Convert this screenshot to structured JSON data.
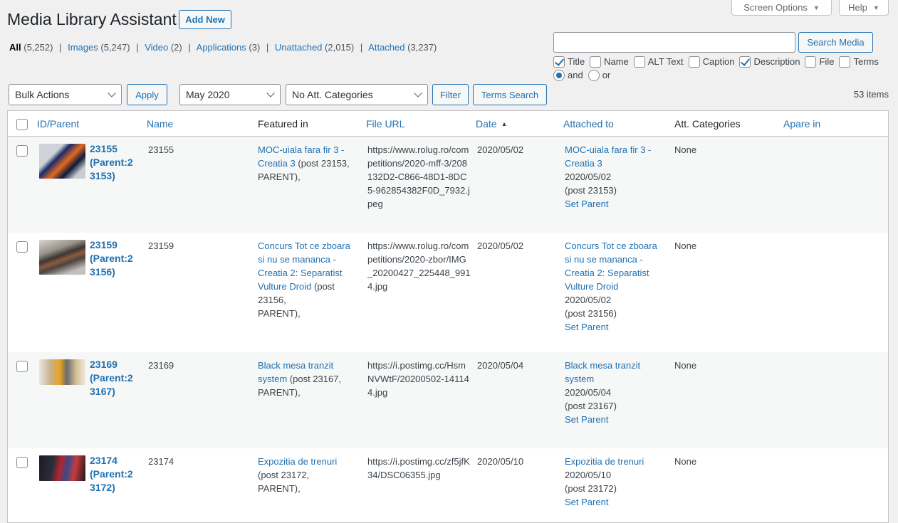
{
  "screen_meta": {
    "screen_options": "Screen Options",
    "help": "Help"
  },
  "page": {
    "title": "Media Library Assistant",
    "add_new": "Add New"
  },
  "views": [
    {
      "label": "All",
      "count": "(5,252)"
    },
    {
      "label": "Images",
      "count": "(5,247)"
    },
    {
      "label": "Video",
      "count": "(2)"
    },
    {
      "label": "Applications",
      "count": "(3)"
    },
    {
      "label": "Unattached",
      "count": "(2,015)"
    },
    {
      "label": "Attached",
      "count": "(3,237)"
    }
  ],
  "search": {
    "value": "",
    "button": "Search Media",
    "fields": [
      {
        "label": "Title",
        "checked": true
      },
      {
        "label": "Name",
        "checked": false
      },
      {
        "label": "ALT Text",
        "checked": false
      },
      {
        "label": "Caption",
        "checked": false
      },
      {
        "label": "Description",
        "checked": true
      },
      {
        "label": "File",
        "checked": false
      },
      {
        "label": "Terms",
        "checked": false
      }
    ],
    "connector": [
      {
        "label": "and",
        "checked": true
      },
      {
        "label": "or",
        "checked": false
      }
    ]
  },
  "tablenav": {
    "bulk_actions": "Bulk Actions",
    "apply": "Apply",
    "month": "May 2020",
    "category": "No Att. Categories",
    "filter": "Filter",
    "terms_search": "Terms Search",
    "items_count": "53 items"
  },
  "columns": {
    "id_parent": "ID/Parent",
    "name": "Name",
    "featured_in": "Featured in",
    "file_url": "File URL",
    "date": "Date",
    "attached_to": "Attached to",
    "att_categories": "Att. Categories",
    "apare_in": "Apare in"
  },
  "rows": [
    {
      "id_line1": "23155",
      "id_line2": "(Parent:2",
      "id_line3": "3153)",
      "name": "23155",
      "featured_link": "MOC-uiala fara fir 3 - Creatia 3",
      "featured_meta": "(post 23153,",
      "featured_meta2": "PARENT),",
      "file_url": "https://www.rolug.ro/competitions/2020-mff-3/208132D2-C866-48D1-8DC5-962854382F0D_7932.jpeg",
      "date": "2020/05/02",
      "attached_link": "MOC-uiala fara fir 3 - Creatia 3",
      "attached_date": "2020/05/02",
      "attached_post": "(post 23153)",
      "set_parent": "Set Parent",
      "categories": "None",
      "thumb_color": "#5b6d8a"
    },
    {
      "id_line1": "23159",
      "id_line2": "(Parent:2",
      "id_line3": "3156)",
      "name": "23159",
      "featured_link": "Concurs Tot ce zboara si nu se mananca - Creatia 2: Separatist Vulture Droid",
      "featured_meta": "(post 23156,",
      "featured_meta2": "PARENT),",
      "file_url": "https://www.rolug.ro/competitions/2020-zbor/IMG_20200427_225448_9914.jpg",
      "date": "2020/05/02",
      "attached_link": "Concurs Tot ce zboara si nu se mananca - Creatia 2: Separatist Vulture Droid",
      "attached_date": "2020/05/02",
      "attached_post": "(post 23156)",
      "set_parent": "Set Parent",
      "categories": "None",
      "thumb_color": "#8a8580"
    },
    {
      "id_line1": "23169",
      "id_line2": "(Parent:2",
      "id_line3": "3167)",
      "name": "23169",
      "featured_link": "Black mesa tranzit system",
      "featured_meta": "(post 23167,",
      "featured_meta2": "PARENT),",
      "file_url": "https://i.postimg.cc/HsmNVWtF/20200502-141144.jpg",
      "date": "2020/05/04",
      "attached_link": "Black mesa tranzit system",
      "attached_date": "2020/05/04",
      "attached_post": "(post 23167)",
      "set_parent": "Set Parent",
      "categories": "None",
      "thumb_color": "#b89a5c"
    },
    {
      "id_line1": "23174",
      "id_line2": "(Parent:2",
      "id_line3": "3172)",
      "name": "23174",
      "featured_link": "Expozitia de trenuri",
      "featured_meta": "(post 23172,",
      "featured_meta2": "PARENT),",
      "file_url": "https://i.postimg.cc/zf5jfK34/DSC06355.jpg",
      "date": "2020/05/10",
      "attached_link": "Expozitia de trenuri",
      "attached_date": "2020/05/10",
      "attached_post": "(post 23172)",
      "set_parent": "Set Parent",
      "categories": "None",
      "thumb_color": "#3a2f3a"
    }
  ]
}
